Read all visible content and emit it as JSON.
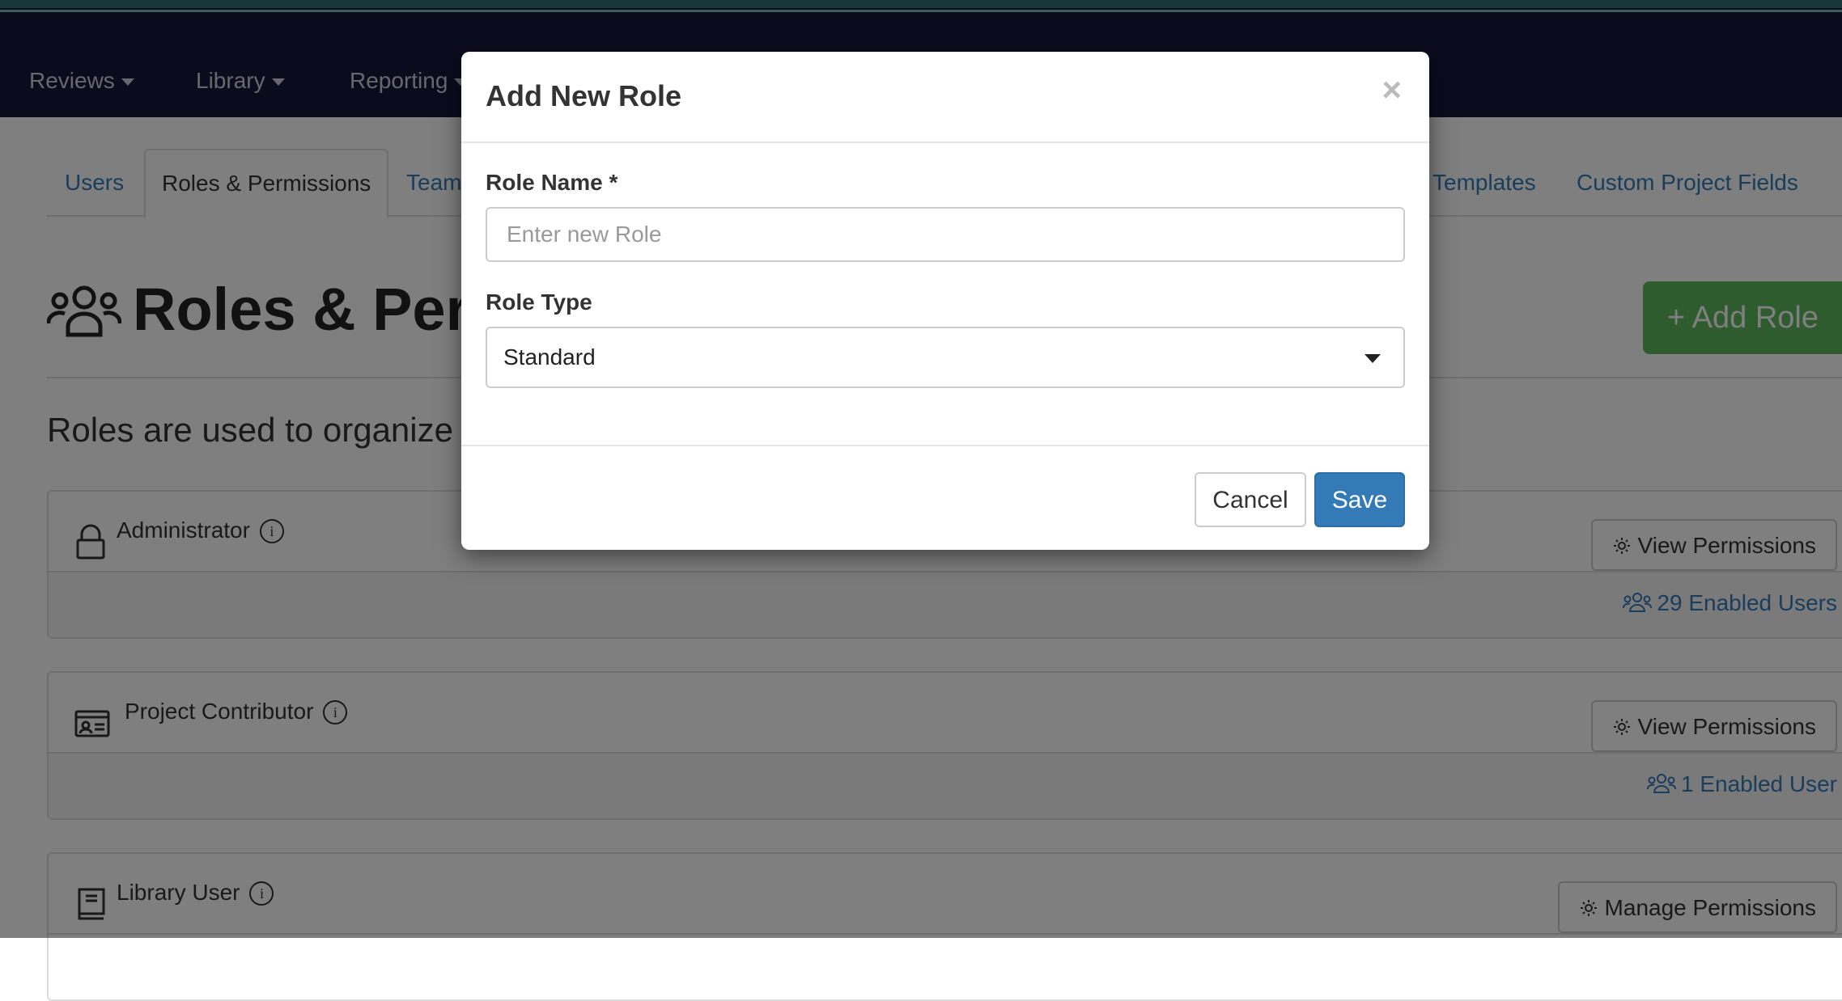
{
  "nav": {
    "items": [
      {
        "label": "Reviews"
      },
      {
        "label": "Library"
      },
      {
        "label": "Reporting"
      }
    ]
  },
  "tabs": [
    {
      "label": "Users"
    },
    {
      "label": "Roles & Permissions"
    },
    {
      "label": "Team"
    },
    {
      "label": "Templates"
    },
    {
      "label": "Custom Project Fields"
    }
  ],
  "page": {
    "title": "Roles & Perm",
    "add_role_label": "+ Add Role",
    "intro": "Roles are used to organize y"
  },
  "roles": [
    {
      "name": "Administrator",
      "button": "View Permissions",
      "users": "29 Enabled Users"
    },
    {
      "name": "Project Contributor",
      "button": "View Permissions",
      "users": "1 Enabled User"
    },
    {
      "name": "Library User",
      "button": "Manage Permissions"
    }
  ],
  "modal": {
    "title": "Add New Role",
    "close": "×",
    "role_name_label": "Role Name *",
    "role_name_placeholder": "Enter new Role",
    "role_name_value": "",
    "role_type_label": "Role Type",
    "role_type_value": "Standard",
    "cancel_label": "Cancel",
    "save_label": "Save"
  },
  "colors": {
    "navbar": "#16163d",
    "link": "#337ab7",
    "primary": "#337ab7",
    "success": "#5cb85c"
  }
}
